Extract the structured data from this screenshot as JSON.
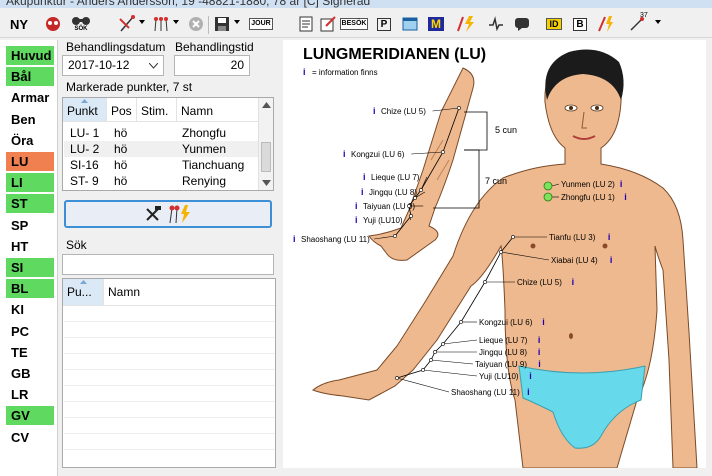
{
  "window": {
    "title": "Akupunktur - Anders Andersson, 19 -48821-1880, 78 år [C] Signerad"
  },
  "toolbar": {
    "new_label": "NY",
    "search_label": "SÖK",
    "journal_label": "JOUR",
    "besok_label": "BESÖK",
    "id_label": "ID",
    "b_label": "B",
    "count_label": "37"
  },
  "sidebar": {
    "items": [
      {
        "label": "Huvud",
        "state": "green"
      },
      {
        "label": "Bål",
        "state": "green"
      },
      {
        "label": "Armar",
        "state": ""
      },
      {
        "label": "Ben",
        "state": ""
      },
      {
        "label": "Öra",
        "state": ""
      },
      {
        "label": "LU",
        "state": "orange"
      },
      {
        "label": "LI",
        "state": "green"
      },
      {
        "label": "ST",
        "state": "green"
      },
      {
        "label": "SP",
        "state": ""
      },
      {
        "label": "HT",
        "state": ""
      },
      {
        "label": "SI",
        "state": "green"
      },
      {
        "label": "BL",
        "state": "green"
      },
      {
        "label": "KI",
        "state": ""
      },
      {
        "label": "PC",
        "state": ""
      },
      {
        "label": "TE",
        "state": ""
      },
      {
        "label": "GB",
        "state": ""
      },
      {
        "label": "LR",
        "state": ""
      },
      {
        "label": "GV",
        "state": "green"
      },
      {
        "label": "CV",
        "state": ""
      }
    ],
    "colors": {
      "green": "#5fd95f",
      "orange": "#f08050"
    }
  },
  "form": {
    "date_label": "Behandlingsdatum",
    "date_value": "2017-10-12",
    "time_label": "Behandlingstid",
    "time_value": "20",
    "marked_label": "Markerade punkter, 7 st"
  },
  "points_table": {
    "headers": [
      "Punkt",
      "Pos",
      "Stim.",
      "Namn"
    ],
    "rows": [
      [
        "LU- 1",
        "hö",
        "",
        "Zhongfu"
      ],
      [
        "LU- 2",
        "hö",
        "",
        "Yunmen"
      ],
      [
        "SI-16",
        "hö",
        "",
        "Tianchuang"
      ],
      [
        "ST- 9",
        "hö",
        "",
        "Renying"
      ]
    ]
  },
  "search": {
    "label": "Sök",
    "value": ""
  },
  "search_table": {
    "headers": [
      "Pu...",
      "Namn"
    ]
  },
  "diagram": {
    "title": "LUNGMERIDIANEN (LU)",
    "legend_i": "i",
    "legend_text": "= information finns",
    "cun5": "5 cun",
    "cun7": "7 cun",
    "arm_labels": [
      "Chize (LU 5)",
      "Kongzui (LU 6)",
      "Lieque (LU 7)",
      "Jingqu (LU 8)",
      "Taiyuan (LU 9)",
      "Yuji (LU10)",
      "Shaoshang (LU 11)"
    ],
    "body_labels": [
      "Yunmen (LU 2)",
      "Zhongfu (LU 1)",
      "Tianfu (LU 3)",
      "Xiabai (LU 4)",
      "Chize (LU 5)",
      "Kongzui (LU 6)",
      "Lieque (LU 7)",
      "Jingqu (LU 8)",
      "Taiyuan (LU 9)",
      "Yuji (LU10)",
      "Shaoshang (LU 11)"
    ],
    "skin_color": "#eeb98e",
    "point_color": "#7ee35a",
    "info_color": "#1c00b4"
  }
}
